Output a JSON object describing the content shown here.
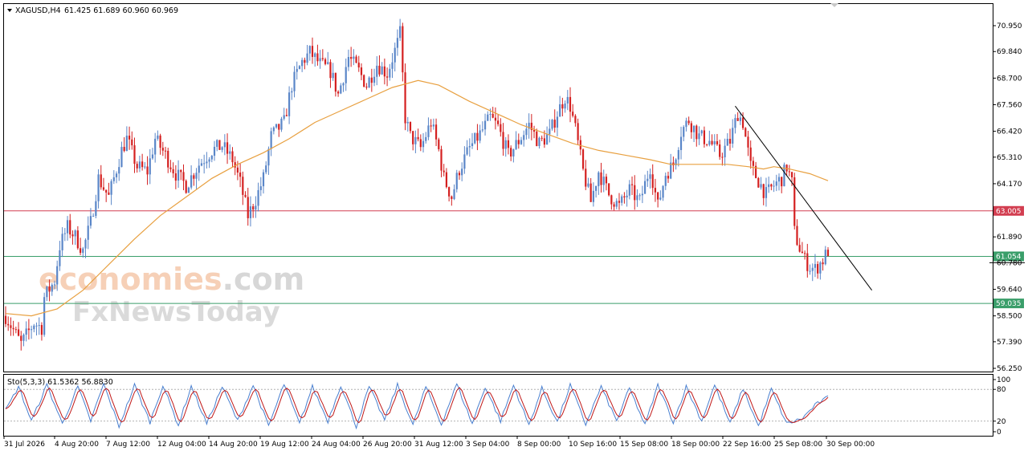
{
  "header": {
    "symbol_label": "XAGUSD,H4",
    "ohlc": "61.425 61.689 60.960 60.969",
    "stoch_label": "Sto(5,3,3) 61.5362 56.8830"
  },
  "watermark": {
    "line1_a": "economies",
    "line1_b": ".com",
    "line2": "FxNewsToday"
  },
  "colors": {
    "bull": "#5a86c8",
    "bear": "#d42020",
    "ma": "#e8a040",
    "resistance": "#d23e50",
    "support": "#3a9e6a",
    "trend": "#000000",
    "stoch_k": "#4a80d0",
    "stoch_d": "#c01818"
  },
  "chart_data": [
    {
      "type": "candlestick",
      "symbol": "XAGUSD",
      "timeframe": "H4",
      "price_axis": {
        "ticks": [
          "70.950",
          "69.840",
          "68.700",
          "67.560",
          "66.420",
          "65.310",
          "64.170",
          "63.005",
          "61.890",
          "61.054",
          "60.780",
          "59.640",
          "59.035",
          "58.500",
          "57.390",
          "56.250"
        ],
        "range": [
          56.25,
          71.9
        ]
      },
      "time_axis": {
        "labels": [
          "31 Jul 2026",
          "4 Aug 20:00",
          "7 Aug 12:00",
          "12 Aug 04:00",
          "14 Aug 20:00",
          "19 Aug 12:00",
          "24 Aug 04:00",
          "26 Aug 20:00",
          "31 Aug 12:00",
          "3 Sep 04:00",
          "8 Sep 00:00",
          "10 Sep 16:00",
          "15 Sep 08:00",
          "18 Sep 00:00",
          "22 Sep 16:00",
          "25 Sep 08:00",
          "30 Sep 00:00"
        ]
      },
      "horizontal_lines": [
        {
          "label": "63.005",
          "price": 63.005,
          "role": "resistance"
        },
        {
          "label": "61.054",
          "price": 61.054,
          "role": "support"
        },
        {
          "label": "59.035",
          "price": 59.035,
          "role": "support"
        }
      ],
      "current_price": {
        "label": "60.780",
        "price": 60.78
      },
      "trendline": {
        "from": [
          "22 Sep 16:00",
          67.5
        ],
        "to": [
          "30 Sep 00:00",
          60.3
        ]
      },
      "close_path": [
        [
          0,
          58.5
        ],
        [
          6,
          57.3
        ],
        [
          11,
          58.2
        ],
        [
          14,
          58.0
        ],
        [
          15,
          59.3
        ],
        [
          19,
          60.0
        ],
        [
          21,
          61.5
        ],
        [
          24,
          62.3
        ],
        [
          27,
          61.9
        ],
        [
          30,
          61.3
        ],
        [
          33,
          62.5
        ],
        [
          36,
          64.4
        ],
        [
          40,
          63.6
        ],
        [
          45,
          65.6
        ],
        [
          47,
          66.1
        ],
        [
          51,
          64.9
        ],
        [
          55,
          64.7
        ],
        [
          58,
          66.1
        ],
        [
          62,
          65.4
        ],
        [
          66,
          64.6
        ],
        [
          70,
          64.1
        ],
        [
          75,
          65.0
        ],
        [
          80,
          65.6
        ],
        [
          84,
          65.8
        ],
        [
          88,
          65.2
        ],
        [
          91,
          64.2
        ],
        [
          94,
          62.8
        ],
        [
          97,
          63.5
        ],
        [
          100,
          64.4
        ],
        [
          103,
          66.2
        ],
        [
          108,
          66.8
        ],
        [
          111,
          68.4
        ],
        [
          115,
          69.4
        ],
        [
          118,
          69.8
        ],
        [
          122,
          69.3
        ],
        [
          126,
          69.0
        ],
        [
          129,
          68.0
        ],
        [
          133,
          69.6
        ],
        [
          137,
          69.0
        ],
        [
          140,
          68.4
        ],
        [
          144,
          69.3
        ],
        [
          148,
          68.9
        ],
        [
          152,
          70.2
        ],
        [
          153,
          70.6
        ],
        [
          155,
          67.0
        ],
        [
          157,
          66.2
        ],
        [
          161,
          65.7
        ],
        [
          165,
          66.8
        ],
        [
          168,
          65.6
        ],
        [
          170,
          64.4
        ],
        [
          173,
          63.6
        ],
        [
          176,
          64.8
        ],
        [
          180,
          65.7
        ],
        [
          184,
          66.3
        ],
        [
          188,
          67.0
        ],
        [
          191,
          66.6
        ],
        [
          195,
          65.4
        ],
        [
          199,
          66.0
        ],
        [
          203,
          66.7
        ],
        [
          207,
          65.9
        ],
        [
          211,
          66.3
        ],
        [
          214,
          67.2
        ],
        [
          217,
          67.9
        ],
        [
          219,
          67.5
        ],
        [
          221,
          66.5
        ],
        [
          224,
          64.7
        ],
        [
          227,
          63.4
        ],
        [
          230,
          64.7
        ],
        [
          234,
          63.7
        ],
        [
          238,
          63.2
        ],
        [
          242,
          63.9
        ],
        [
          246,
          63.4
        ],
        [
          250,
          64.9
        ],
        [
          253,
          63.2
        ],
        [
          256,
          64.6
        ],
        [
          259,
          65.0
        ],
        [
          262,
          66.4
        ],
        [
          265,
          66.9
        ],
        [
          269,
          66.2
        ],
        [
          273,
          66.0
        ],
        [
          277,
          65.4
        ],
        [
          281,
          66.0
        ],
        [
          284,
          67.2
        ],
        [
          286,
          66.8
        ],
        [
          289,
          64.9
        ],
        [
          292,
          64.3
        ],
        [
          295,
          63.7
        ],
        [
          298,
          64.1
        ],
        [
          301,
          64.4
        ],
        [
          303,
          64.9
        ],
        [
          305,
          64.2
        ],
        [
          306,
          62.1
        ],
        [
          308,
          61.4
        ],
        [
          310,
          60.9
        ],
        [
          312,
          60.6
        ],
        [
          314,
          60.5
        ],
        [
          317,
          60.9
        ],
        [
          319,
          61.3
        ]
      ],
      "ma_path": [
        [
          0,
          58.6
        ],
        [
          10,
          58.5
        ],
        [
          20,
          58.8
        ],
        [
          30,
          59.6
        ],
        [
          40,
          60.7
        ],
        [
          50,
          61.8
        ],
        [
          60,
          62.8
        ],
        [
          70,
          63.6
        ],
        [
          80,
          64.4
        ],
        [
          90,
          65.0
        ],
        [
          100,
          65.5
        ],
        [
          110,
          66.1
        ],
        [
          120,
          66.8
        ],
        [
          130,
          67.3
        ],
        [
          140,
          67.8
        ],
        [
          150,
          68.3
        ],
        [
          160,
          68.6
        ],
        [
          168,
          68.4
        ],
        [
          180,
          67.7
        ],
        [
          190,
          67.2
        ],
        [
          200,
          66.7
        ],
        [
          210,
          66.3
        ],
        [
          220,
          65.9
        ],
        [
          230,
          65.6
        ],
        [
          240,
          65.4
        ],
        [
          250,
          65.2
        ],
        [
          258,
          65.0
        ],
        [
          270,
          65.0
        ],
        [
          280,
          65.0
        ],
        [
          288,
          64.9
        ],
        [
          294,
          64.8
        ],
        [
          298,
          64.9
        ],
        [
          304,
          64.8
        ],
        [
          312,
          64.6
        ],
        [
          319,
          64.3
        ]
      ]
    },
    {
      "type": "line",
      "indicator": "Stochastic",
      "params": "5,3,3",
      "y_axis": {
        "ticks": [
          "100",
          "80",
          "20",
          "0"
        ],
        "range": [
          0,
          100
        ]
      },
      "levels": [
        80,
        20
      ],
      "series": [
        {
          "name": "%K",
          "values": []
        },
        {
          "name": "%D",
          "values": []
        }
      ],
      "cycle_peaks": [
        [
          0,
          40
        ],
        [
          5,
          85
        ],
        [
          10,
          20
        ],
        [
          16,
          88
        ],
        [
          22,
          15
        ],
        [
          28,
          85
        ],
        [
          33,
          20
        ],
        [
          38,
          90
        ],
        [
          44,
          10
        ],
        [
          50,
          88
        ],
        [
          56,
          18
        ],
        [
          61,
          88
        ],
        [
          67,
          12
        ],
        [
          72,
          86
        ],
        [
          78,
          15
        ],
        [
          84,
          85
        ],
        [
          90,
          20
        ],
        [
          96,
          88
        ],
        [
          102,
          10
        ],
        [
          108,
          90
        ],
        [
          114,
          15
        ],
        [
          119,
          85
        ],
        [
          125,
          20
        ],
        [
          130,
          88
        ],
        [
          136,
          10
        ],
        [
          141,
          85
        ],
        [
          147,
          22
        ],
        [
          152,
          88
        ],
        [
          158,
          12
        ],
        [
          163,
          85
        ],
        [
          169,
          14
        ],
        [
          175,
          90
        ],
        [
          181,
          15
        ],
        [
          186,
          85
        ],
        [
          192,
          20
        ],
        [
          197,
          88
        ],
        [
          203,
          12
        ],
        [
          208,
          82
        ],
        [
          214,
          18
        ],
        [
          219,
          88
        ],
        [
          225,
          14
        ],
        [
          231,
          85
        ],
        [
          237,
          20
        ],
        [
          242,
          82
        ],
        [
          248,
          12
        ],
        [
          253,
          88
        ],
        [
          259,
          18
        ],
        [
          264,
          85
        ],
        [
          270,
          20
        ],
        [
          275,
          88
        ],
        [
          281,
          15
        ],
        [
          286,
          82
        ],
        [
          292,
          10
        ],
        [
          297,
          80
        ],
        [
          303,
          15
        ],
        [
          309,
          25
        ],
        [
          314,
          50
        ],
        [
          319,
          65
        ]
      ]
    }
  ]
}
